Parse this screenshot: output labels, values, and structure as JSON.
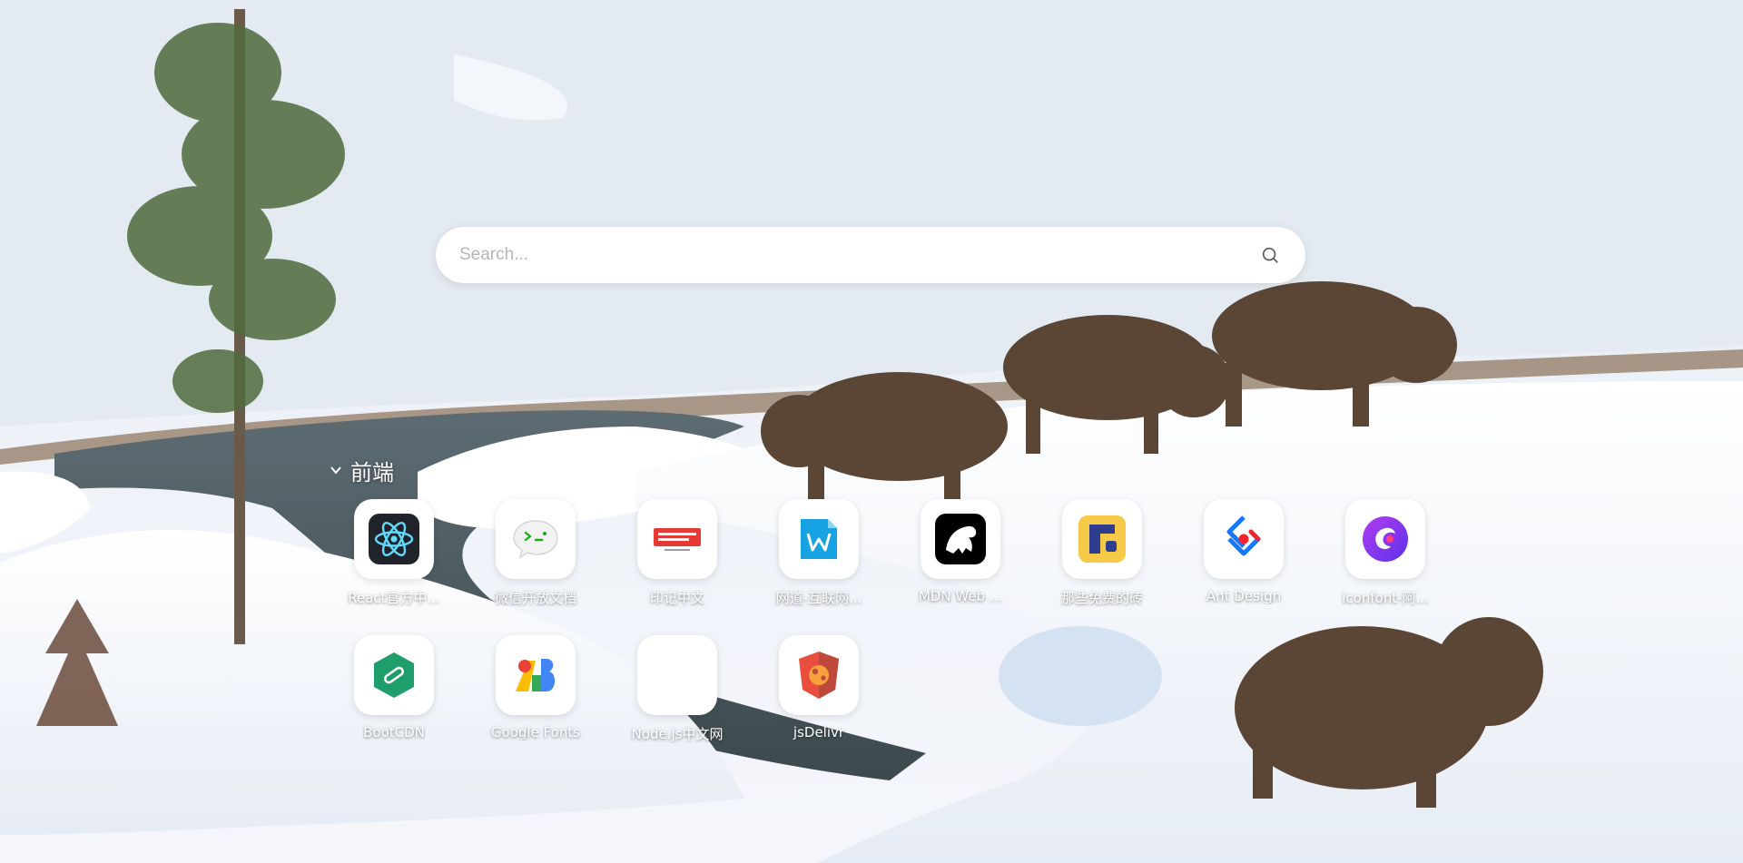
{
  "search": {
    "placeholder": "Search..."
  },
  "group": {
    "title": "前端",
    "expanded": true
  },
  "apps": [
    {
      "label": "React官方中...",
      "icon": "react-icon"
    },
    {
      "label": "微信开放文档",
      "icon": "wechat-devtools-icon"
    },
    {
      "label": "印记中文",
      "icon": "docschina-icon"
    },
    {
      "label": "网道-互联网...",
      "icon": "wangdoc-icon"
    },
    {
      "label": "MDN Web ...",
      "icon": "mdn-icon"
    },
    {
      "label": "那些免费的砖",
      "icon": "free-bricks-icon"
    },
    {
      "label": "Ant Design",
      "icon": "ant-design-icon"
    },
    {
      "label": "iconfont-阿...",
      "icon": "iconfont-icon"
    },
    {
      "label": "BootCDN",
      "icon": "bootcdn-icon"
    },
    {
      "label": "Google Fonts",
      "icon": "google-fonts-icon"
    },
    {
      "label": "Node.js中文网",
      "icon": "nodejs-icon"
    },
    {
      "label": "jsDelivr",
      "icon": "jsdelivr-icon"
    }
  ]
}
